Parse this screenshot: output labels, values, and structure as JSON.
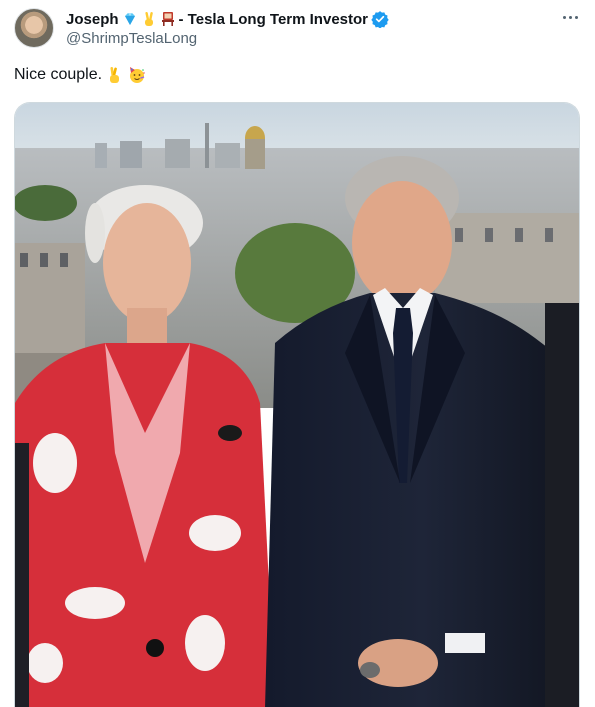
{
  "author": {
    "display_name": "Joseph",
    "display_name_suffix": "- Tesla Long Term Investor",
    "handle": "@ShrimpTeslaLong",
    "emojis": [
      "gem-icon",
      "victory-hand-icon",
      "chair-icon"
    ],
    "verified_color": "#1d9bf0"
  },
  "tweet": {
    "text": "Nice couple.",
    "emojis": [
      "crossed-fingers-icon",
      "partying-face-icon"
    ]
  },
  "more_menu": {
    "icon": "more-horizontal-icon"
  },
  "media": {
    "description_icon": "photo-image"
  }
}
